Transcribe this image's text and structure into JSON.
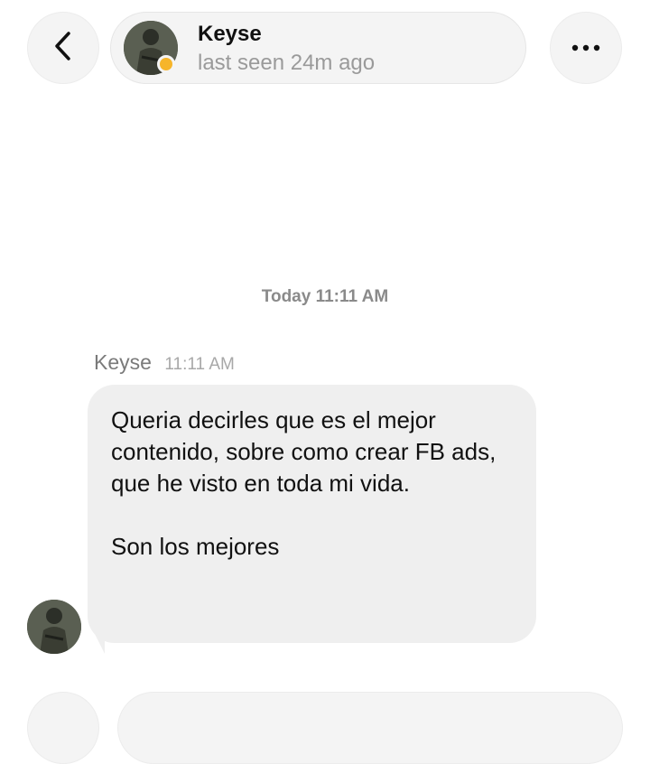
{
  "header": {
    "back_icon": "chevron-left-icon",
    "contact": {
      "name": "Keyse",
      "status": "last seen 24m ago",
      "presence_color": "#f6b52a"
    },
    "more_icon": "more-horizontal-icon"
  },
  "conversation": {
    "day_separator": "Today 11:11 AM",
    "messages": [
      {
        "sender": "Keyse",
        "time": "11:11 AM",
        "paragraphs": [
          "Queria decirles que es el mejor contenido, sobre como crear FB ads, que he visto en toda mi vida.",
          "Son los mejores"
        ]
      }
    ]
  },
  "colors": {
    "bubble_background": "#efefef",
    "button_background": "#f4f4f4",
    "secondary_text": "#9a9a9a"
  }
}
